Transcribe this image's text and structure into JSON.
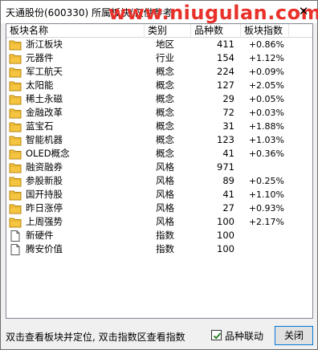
{
  "window": {
    "title": "天通股份(600330)  所属板块(仅供参考",
    "watermark": "www.niugulan.com"
  },
  "table": {
    "columns": [
      "板块名称",
      "类别",
      "品种数",
      "板块指数"
    ],
    "rows": [
      {
        "icon": "folder-icon",
        "name": "浙江板块",
        "type": "地区",
        "count": "411",
        "index": "+0.86%"
      },
      {
        "icon": "folder-icon",
        "name": "元器件",
        "type": "行业",
        "count": "154",
        "index": "+1.12%"
      },
      {
        "icon": "folder-icon",
        "name": "军工航天",
        "type": "概念",
        "count": "224",
        "index": "+0.09%"
      },
      {
        "icon": "folder-icon",
        "name": "太阳能",
        "type": "概念",
        "count": "127",
        "index": "+2.05%"
      },
      {
        "icon": "folder-icon",
        "name": "稀土永磁",
        "type": "概念",
        "count": "29",
        "index": "+0.05%"
      },
      {
        "icon": "folder-icon",
        "name": "金融改革",
        "type": "概念",
        "count": "72",
        "index": "+0.03%"
      },
      {
        "icon": "folder-icon",
        "name": "蓝宝石",
        "type": "概念",
        "count": "31",
        "index": "+1.88%"
      },
      {
        "icon": "folder-icon",
        "name": "智能机器",
        "type": "概念",
        "count": "123",
        "index": "+1.03%"
      },
      {
        "icon": "folder-icon",
        "name": "OLED概念",
        "type": "概念",
        "count": "41",
        "index": "+0.36%"
      },
      {
        "icon": "folder-icon",
        "name": "融资融券",
        "type": "风格",
        "count": "971",
        "index": ""
      },
      {
        "icon": "folder-icon",
        "name": "参股新股",
        "type": "风格",
        "count": "89",
        "index": "+0.25%"
      },
      {
        "icon": "folder-icon",
        "name": "国开持股",
        "type": "风格",
        "count": "41",
        "index": "+1.10%"
      },
      {
        "icon": "folder-icon",
        "name": "昨日涨停",
        "type": "风格",
        "count": "27",
        "index": "+0.93%"
      },
      {
        "icon": "folder-icon",
        "name": "上周强势",
        "type": "风格",
        "count": "100",
        "index": "+2.17%"
      },
      {
        "icon": "document-icon",
        "name": "新硬件",
        "type": "指数",
        "count": "100",
        "index": ""
      },
      {
        "icon": "document-icon",
        "name": "腾安价值",
        "type": "指数",
        "count": "100",
        "index": ""
      }
    ]
  },
  "footer": {
    "hint": "双击查看板块并定位, 双击指数区查看指数",
    "checkbox_label": "品种联动",
    "checkbox_checked": true,
    "close_label": "关闭"
  },
  "colors": {
    "folder": "#f5c542",
    "watermark": "#e8312a",
    "button_border": "#0078d7"
  }
}
